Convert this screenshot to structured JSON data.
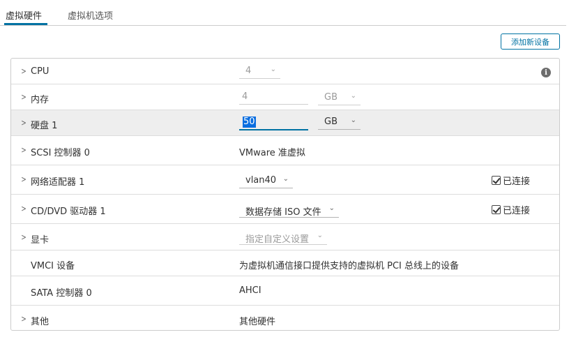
{
  "tabs": [
    {
      "label": "虚拟硬件"
    },
    {
      "label": "虚拟机选项"
    }
  ],
  "toolbar": {
    "add_device_label": "添加新设备"
  },
  "rows": [
    {
      "label": "CPU",
      "value": "4"
    },
    {
      "label": "内存",
      "value": "4",
      "unit": "GB"
    },
    {
      "label": "硬盘 1",
      "value": "50",
      "unit": "GB"
    },
    {
      "label": "SCSI 控制器 0",
      "value": "VMware 准虚拟"
    },
    {
      "label": "网络适配器 1",
      "value": "vlan40",
      "checkbox_label": "已连接",
      "checked": true
    },
    {
      "label": "CD/DVD 驱动器 1",
      "value": "数据存储 ISO 文件",
      "checkbox_label": "已连接",
      "checked": true
    },
    {
      "label": "显卡",
      "value": "指定自定义设置"
    },
    {
      "label": "VMCI 设备",
      "value": "为虚拟机通信接口提供支持的虚拟机 PCI 总线上的设备"
    },
    {
      "label": "SATA 控制器 0",
      "value": "AHCI"
    },
    {
      "label": "其他",
      "value": "其他硬件"
    }
  ],
  "colors": {
    "accent": "#0072a3",
    "selection": "#0a6ee0",
    "highlight_row": "#eeeeee"
  },
  "icons": {
    "expand": "chevron-right-icon",
    "info": "info-icon",
    "dropdown": "chevron-down-icon",
    "check": "checkbox-checked-icon"
  }
}
